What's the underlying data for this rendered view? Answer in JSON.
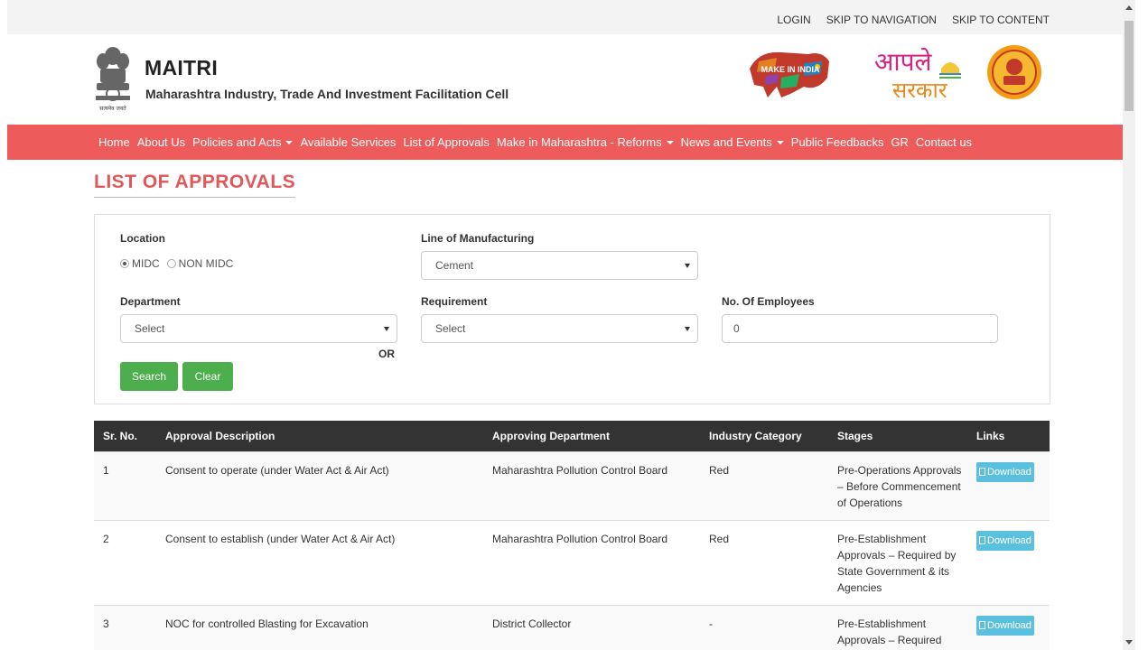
{
  "toplinks": [
    "LOGIN",
    "SKIP TO NAVIGATION",
    "SKIP TO CONTENT"
  ],
  "header": {
    "title": "MAITRI",
    "subtitle": "Maharashtra Industry, Trade And Investment Facilitation Cell",
    "emblem_caption": "सत्यमेव जयते",
    "make_in_india": "MAKE IN INDIA",
    "aaple_sarkar_line1": "आपले",
    "aaple_sarkar_line2": "सरकार"
  },
  "nav": {
    "items": [
      {
        "label": "Home",
        "dropdown": false
      },
      {
        "label": "About Us",
        "dropdown": false
      },
      {
        "label": "Policies and Acts",
        "dropdown": true
      },
      {
        "label": "Available Services",
        "dropdown": false
      },
      {
        "label": "List of Approvals",
        "dropdown": false
      },
      {
        "label": "Make in Maharashtra - Reforms",
        "dropdown": true
      },
      {
        "label": "News and Events",
        "dropdown": true
      },
      {
        "label": "Public Feedbacks",
        "dropdown": false
      },
      {
        "label": "GR",
        "dropdown": false
      },
      {
        "label": "Contact us",
        "dropdown": false
      }
    ]
  },
  "page_title": "LIST OF APPROVALS",
  "filters": {
    "location_label": "Location",
    "location_options": [
      "MIDC",
      "NON MIDC"
    ],
    "location_selected": "MIDC",
    "line_label": "Line of Manufacturing",
    "line_value": "Cement",
    "department_label": "Department",
    "department_value": "Select",
    "or_label": "OR",
    "requirement_label": "Requirement",
    "requirement_value": "Select",
    "employees_label": "No. Of Employees",
    "employees_value": "0",
    "search_button": "Search",
    "clear_button": "Clear"
  },
  "table": {
    "headers": [
      "Sr. No.",
      "Approval Description",
      "Approving Department",
      "Industry Category",
      "Stages",
      "Links"
    ],
    "download_label": "Download",
    "rows": [
      {
        "sr": "1",
        "description": "Consent to operate (under Water Act & Air Act)",
        "department": "Maharashtra Pollution Control Board",
        "category": "Red",
        "stages": "Pre-Operations Approvals – Before Commencement of Operations"
      },
      {
        "sr": "2",
        "description": "Consent to establish (under Water Act & Air Act)",
        "department": "Maharashtra Pollution Control Board",
        "category": "Red",
        "stages": "Pre-Establishment Approvals – Required by State Government & its Agencies"
      },
      {
        "sr": "3",
        "description": "NOC for controlled Blasting for Excavation",
        "department": "District Collector",
        "category": "-",
        "stages": "Pre-Establishment Approvals – Required"
      }
    ]
  },
  "colors": {
    "nav_bg": "#ed5b5b",
    "title_color": "#e0585a",
    "button_green": "#4cae4c",
    "download_blue": "#5bc0de",
    "table_header_bg": "#333333"
  }
}
